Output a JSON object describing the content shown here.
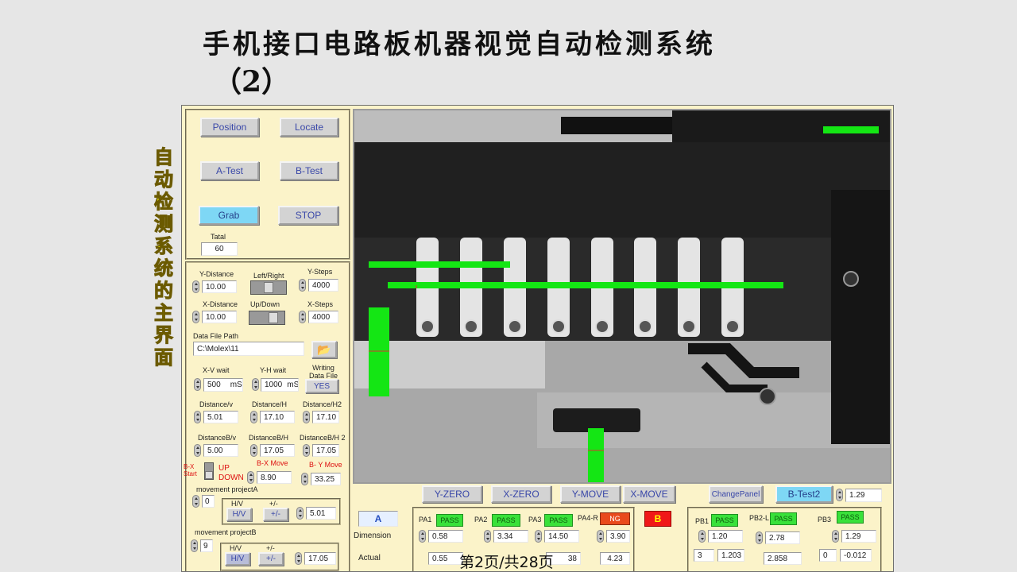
{
  "slide": {
    "title_line1": "手机接口电路板机器视觉自动检测系统",
    "title_line2": "（2）",
    "side_caption": [
      "自",
      "动",
      "检",
      "测",
      "系",
      "统",
      "的",
      "主",
      "界",
      "面"
    ],
    "footer": "第2页/共28页"
  },
  "controls": {
    "position": "Position",
    "locate": "Locate",
    "a_test": "A-Test",
    "b_test": "B-Test",
    "grab": "Grab",
    "stop": "STOP",
    "tatal_label": "Tatal",
    "tatal_value": "60"
  },
  "motion": {
    "y_distance_label": "Y-Distance",
    "y_distance": "10.00",
    "left_right_label": "Left/Right",
    "y_steps_label": "Y-Steps",
    "y_steps": "4000",
    "x_distance_label": "X-Distance",
    "x_distance": "10.00",
    "up_down_label": "Up/Down",
    "x_steps_label": "X-Steps",
    "x_steps": "4000",
    "data_file_path_label": "Data File Path",
    "data_file_path": "C:\\Molex\\11",
    "xv_wait_label": "X-V wait",
    "xv_wait": "500",
    "xv_unit": "mS",
    "yh_wait_label": "Y-H wait",
    "yh_wait": "1000",
    "yh_unit": "mS",
    "writing_label": "Writing Data File",
    "writing_value": "YES",
    "dist_v_label": "Distance/v",
    "dist_v": "5.01",
    "dist_h_label": "Distance/H",
    "dist_h": "17.10",
    "dist_h2_label": "Distance/H2",
    "dist_h2": "17.10",
    "distb_v_label": "DistanceB/v",
    "distb_v": "5.00",
    "distb_h_label": "DistanceB/H",
    "distb_h": "17.05",
    "distb_h2_label": "DistanceB/H 2",
    "distb_h2": "17.05",
    "bx_start_label": "B-X Start",
    "up_label": "UP",
    "down_label": "DOWN",
    "bx_move_label": "B-X Move",
    "bx_move": "8.90",
    "by_move_label": "B- Y Move",
    "by_move": "33.25",
    "proj_a_label": "movement projectA",
    "proj_a_value": "0",
    "proj_b_label": "movement projectB",
    "proj_b_value": "9",
    "hv_label": "H/V",
    "pm_label": "+/-",
    "hv_btn": "H/V",
    "pm_btn": "+/-",
    "proj_a_result": "5.01",
    "proj_b_result": "17.05"
  },
  "bottom": {
    "y_zero": "Y-ZERO",
    "x_zero": "X-ZERO",
    "y_move": "Y-MOVE",
    "x_move": "X-MOVE",
    "b_indicator": "B",
    "change_panel": "ChangePanel",
    "b_test2": "B-Test2",
    "b_test2_value": "1.29",
    "a_label": "A",
    "dimension_label": "Dimension",
    "actual_label": "Actual",
    "pa": [
      {
        "label": "PA1",
        "status": "PASS",
        "dim": "0.58",
        "actual": "0.55"
      },
      {
        "label": "PA2",
        "status": "PASS",
        "dim": "3.34",
        "actual": ""
      },
      {
        "label": "PA3",
        "status": "PASS",
        "dim": "14.50",
        "actual": "38"
      },
      {
        "label": "PA4-R",
        "status": "NG",
        "dim": "3.90",
        "actual": "4.23"
      }
    ],
    "pb": [
      {
        "label": "PB1",
        "status": "PASS",
        "dim": "1.20",
        "spin": "3",
        "actual": "1.203"
      },
      {
        "label": "PB2-L",
        "status": "PASS",
        "dim": "2.78",
        "actual": "2.858"
      },
      {
        "label": "PB3",
        "status": "PASS",
        "dim": "1.29",
        "spin": "0",
        "actual": "-0.012"
      }
    ]
  },
  "colors": {
    "panel": "#fbf3c9",
    "pass": "#39e13a",
    "ng": "#e94a1c",
    "overlay": "#14e614"
  }
}
